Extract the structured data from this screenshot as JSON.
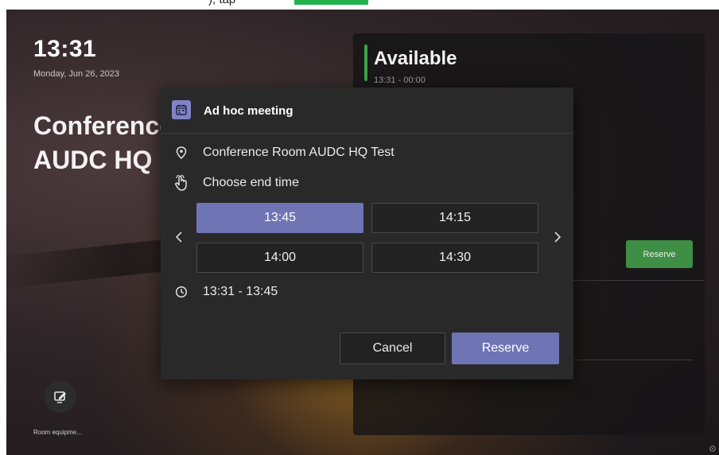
{
  "caption": {
    "text": "), tap"
  },
  "screen": {
    "clock": "13:31",
    "date": "Monday, Jun 26, 2023",
    "room_title_line1": "Conference",
    "room_title_line2": "AUDC HQ",
    "room_equipment_label": "Room equipme..."
  },
  "right_panel": {
    "status": "Available",
    "time_range": "13:31 - 00:00",
    "reserve_label": "Reserve"
  },
  "dialog": {
    "title": "Ad hoc meeting",
    "location": "Conference Room AUDC HQ Test",
    "choose_label": "Choose end time",
    "end_times": [
      "13:45",
      "14:15",
      "14:00",
      "14:30"
    ],
    "selected_time": "13:45",
    "summary_range": "13:31 - 13:45",
    "cancel_label": "Cancel",
    "reserve_label": "Reserve"
  },
  "colors": {
    "accent": "#6f74b4",
    "available_green": "#3fa34d",
    "dialog_bg": "#292929"
  },
  "icons": {
    "calendar": "calendar-icon",
    "location": "location-pin-icon",
    "hand": "hand-pointer-icon",
    "clock": "clock-icon",
    "prev": "chevron-left-icon",
    "next": "chevron-right-icon",
    "equipment": "edit-icon",
    "settings": "gear-icon"
  }
}
